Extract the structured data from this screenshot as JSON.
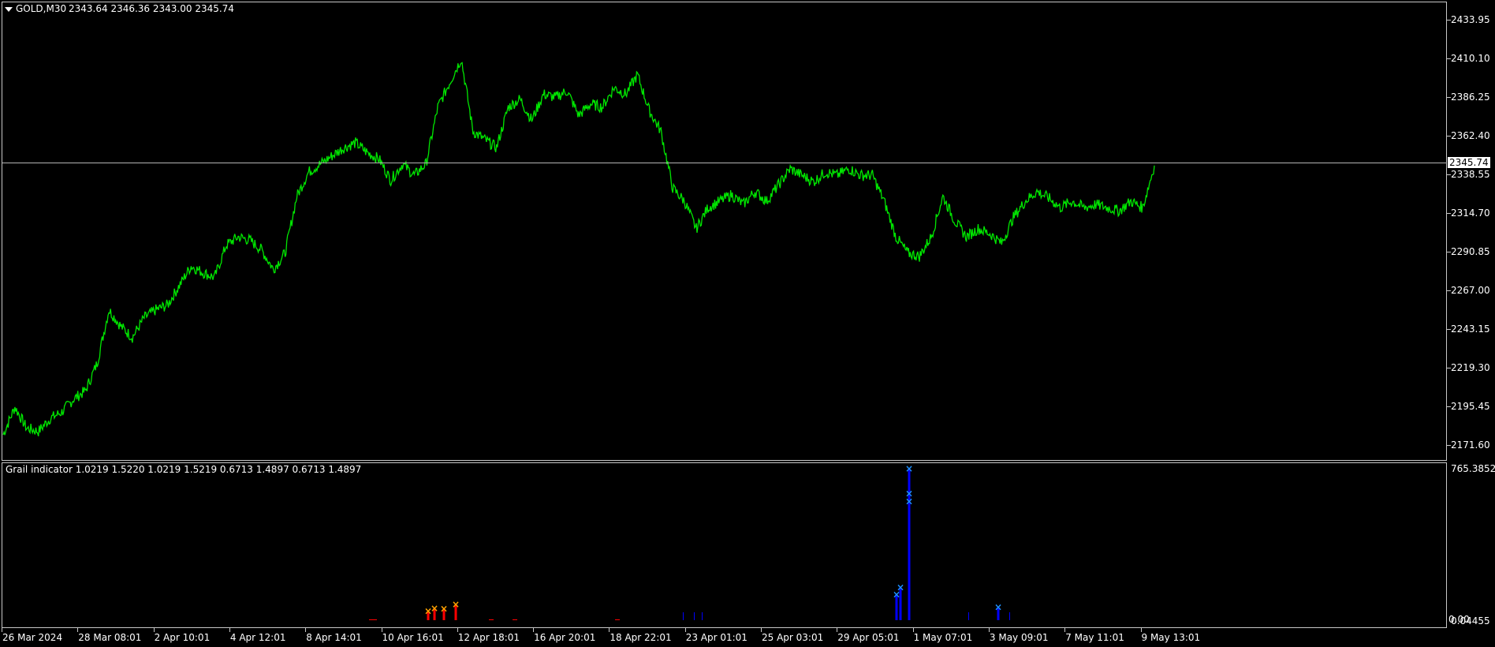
{
  "main_chart": {
    "symbol_label": "GOLD,M30",
    "ohlc_label": "2343.64 2346.36 2343.00 2345.74",
    "current_price_label": "2345.74",
    "line_color": "#00e600",
    "y_axis_labels": [
      "2433.95",
      "2410.10",
      "2386.25",
      "2362.40",
      "2338.55",
      "2314.70",
      "2290.85",
      "2267.00",
      "2243.15",
      "2219.30",
      "2195.45",
      "2171.60"
    ]
  },
  "indicator": {
    "label": "Grail indicator 1.0219 1.5220 1.0219 1.5219 0.6713 1.4897 0.6713 1.4897",
    "y_axis_top": "765.3852",
    "y_axis_bottom": "0.04455",
    "y_axis_zero": "0.00",
    "sell_color": "#ff0000",
    "sell_marker_color": "#ffa500",
    "buy_color": "#0000ff",
    "buy_marker_color": "#1e90ff"
  },
  "x_axis_labels": [
    "26 Mar 2024",
    "28 Mar 08:01",
    "2 Apr 10:01",
    "4 Apr 12:01",
    "8 Apr 14:01",
    "10 Apr 16:01",
    "12 Apr 18:01",
    "16 Apr 20:01",
    "18 Apr 22:01",
    "23 Apr 01:01",
    "25 Apr 03:01",
    "29 Apr 05:01",
    "1 May 07:01",
    "3 May 09:01",
    "7 May 11:01",
    "9 May 13:01"
  ],
  "chart_data": {
    "type": "line",
    "series": [
      {
        "values": [
          2178,
          2195,
          2182,
          2180,
          2188,
          2192,
          2200,
          2205,
          2222,
          2255,
          2245,
          2238,
          2250,
          2255,
          2258,
          2270,
          2282,
          2278,
          2275,
          2295,
          2300,
          2298,
          2292,
          2280,
          2290,
          2325,
          2340,
          2345,
          2350,
          2355,
          2358,
          2352,
          2348,
          2335,
          2345,
          2338,
          2345,
          2380,
          2395,
          2410,
          2365,
          2360,
          2355,
          2380,
          2385,
          2372,
          2388,
          2386,
          2390,
          2375,
          2382,
          2380,
          2392,
          2388,
          2400,
          2378,
          2365,
          2330,
          2322,
          2305,
          2318,
          2322,
          2326,
          2320,
          2328,
          2322,
          2332,
          2342,
          2338,
          2334,
          2340,
          2338,
          2342,
          2338,
          2338,
          2322,
          2300,
          2290,
          2288,
          2300,
          2325,
          2310,
          2300,
          2305,
          2302,
          2296,
          2312,
          2322,
          2328,
          2324,
          2318,
          2322,
          2318,
          2320,
          2318,
          2316,
          2322,
          2318,
          2344
        ]
      }
    ],
    "ylim": [
      2171.6,
      2433.95
    ]
  },
  "indicator_data": {
    "sell_bars": [
      {
        "date": "11 Apr",
        "value": 45
      },
      {
        "date": "11 Apr",
        "value": 60
      },
      {
        "date": "11 Apr",
        "value": 58
      },
      {
        "date": "12 Apr",
        "value": 80
      }
    ],
    "buy_bars": [
      {
        "date": "30 Apr",
        "value": 130
      },
      {
        "date": "30 Apr",
        "value": 165
      },
      {
        "date": "1 May",
        "value": 765
      },
      {
        "date": "3 May",
        "value": 65
      }
    ]
  }
}
